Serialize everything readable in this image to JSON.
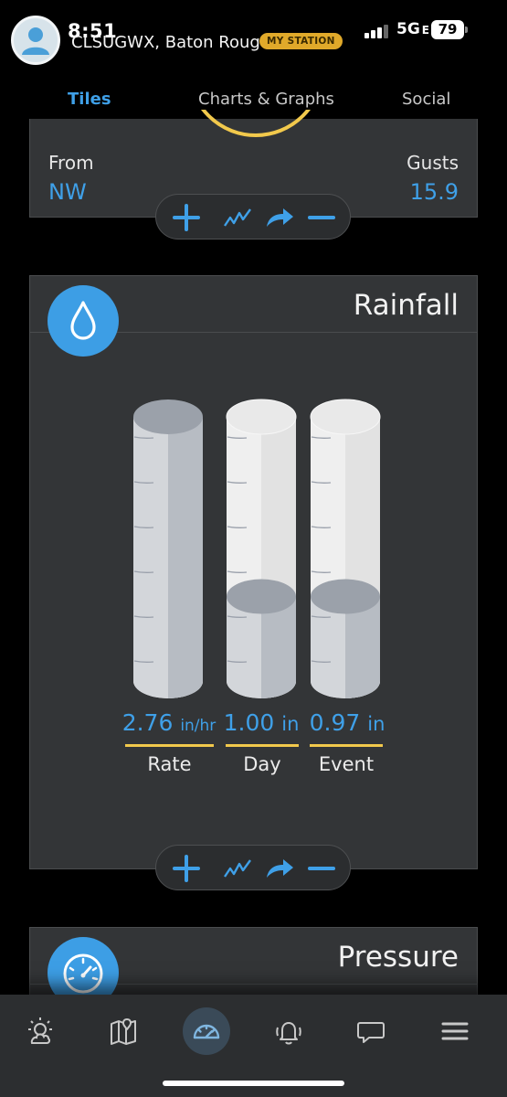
{
  "status_bar": {
    "time": "8:51",
    "network": "5G",
    "battery": "79"
  },
  "header": {
    "station_name": "CLSUGWX, Baton Rouge",
    "station_badge": "MY STATION"
  },
  "tabs": [
    {
      "label": "Tiles",
      "active": true
    },
    {
      "label": "Charts & Graphs",
      "active": false
    },
    {
      "label": "Social",
      "active": false
    }
  ],
  "wind_tile": {
    "from_label": "From",
    "from_value": "NW",
    "gusts_label": "Gusts",
    "gusts_value": "15.9"
  },
  "rainfall_tile": {
    "title": "Rainfall",
    "icon": "water-drop-icon",
    "gauges": [
      {
        "value": "2.76",
        "unit": "in/hr",
        "label": "Rate",
        "fill_fraction": 1.0
      },
      {
        "value": "1.00",
        "unit": "in",
        "label": "Day",
        "fill_fraction": 0.32
      },
      {
        "value": "0.97",
        "unit": "in",
        "label": "Event",
        "fill_fraction": 0.32
      }
    ]
  },
  "pressure_tile": {
    "title": "Pressure",
    "icon": "gauge-icon"
  },
  "toolbar_actions": [
    "plus-icon",
    "chart-line-icon",
    "share-arrow-icon",
    "minus-icon"
  ],
  "bottom_nav": [
    {
      "icon": "weather-sun-cloud-icon",
      "active": false
    },
    {
      "icon": "map-pin-icon",
      "active": false
    },
    {
      "icon": "dashboard-gauge-icon",
      "active": true
    },
    {
      "icon": "bell-icon",
      "active": false
    },
    {
      "icon": "chat-bubble-icon",
      "active": false
    },
    {
      "icon": "hamburger-menu-icon",
      "active": false
    }
  ],
  "colors": {
    "accent_blue": "#3fa0e8",
    "gauge_yellow": "#f2c94c",
    "badge_gold": "#e0a92a",
    "tile_bg": "#333537"
  }
}
